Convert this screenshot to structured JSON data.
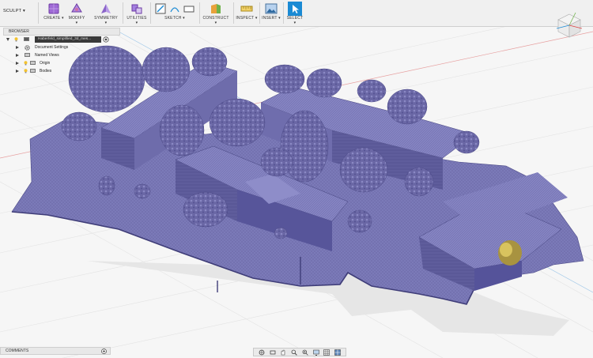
{
  "workspace": {
    "label": "SCULPT",
    "icon": "chevron-down-icon"
  },
  "ribbon": {
    "groups": [
      {
        "label": "CREATE",
        "icon": "box-icon"
      },
      {
        "label": "MODIFY",
        "icon": "modify-icon"
      },
      {
        "label": "SYMMETRY",
        "icon": "symmetry-icon"
      },
      {
        "label": "UTILITIES",
        "icon": "utilities-icon"
      },
      {
        "label": "SKETCH",
        "icon": "sketch-icon"
      },
      {
        "label": "CONSTRUCT",
        "icon": "construct-icon"
      },
      {
        "label": "INSPECT",
        "icon": "inspect-icon"
      },
      {
        "label": "INSERT",
        "icon": "insert-icon"
      },
      {
        "label": "SELECT",
        "icon": "select-icon"
      }
    ]
  },
  "browser": {
    "title": "BROWSER",
    "document": "Haberfeld_simplified_3d_mes...",
    "items": [
      {
        "label": "Document Settings",
        "icon": "gear-icon"
      },
      {
        "label": "Named Views",
        "icon": "folder-icon"
      },
      {
        "label": "Origin",
        "icon": "folder-icon"
      },
      {
        "label": "Bodies",
        "icon": "folder-icon"
      }
    ]
  },
  "comments": {
    "title": "COMMENTS"
  },
  "colors": {
    "mesh": "#7a79b6",
    "mesh_dark": "#4c4a86",
    "accent": "#1a8ad4",
    "ground_shadow": "#e4e4e4",
    "tree": "#6d6aa8"
  }
}
